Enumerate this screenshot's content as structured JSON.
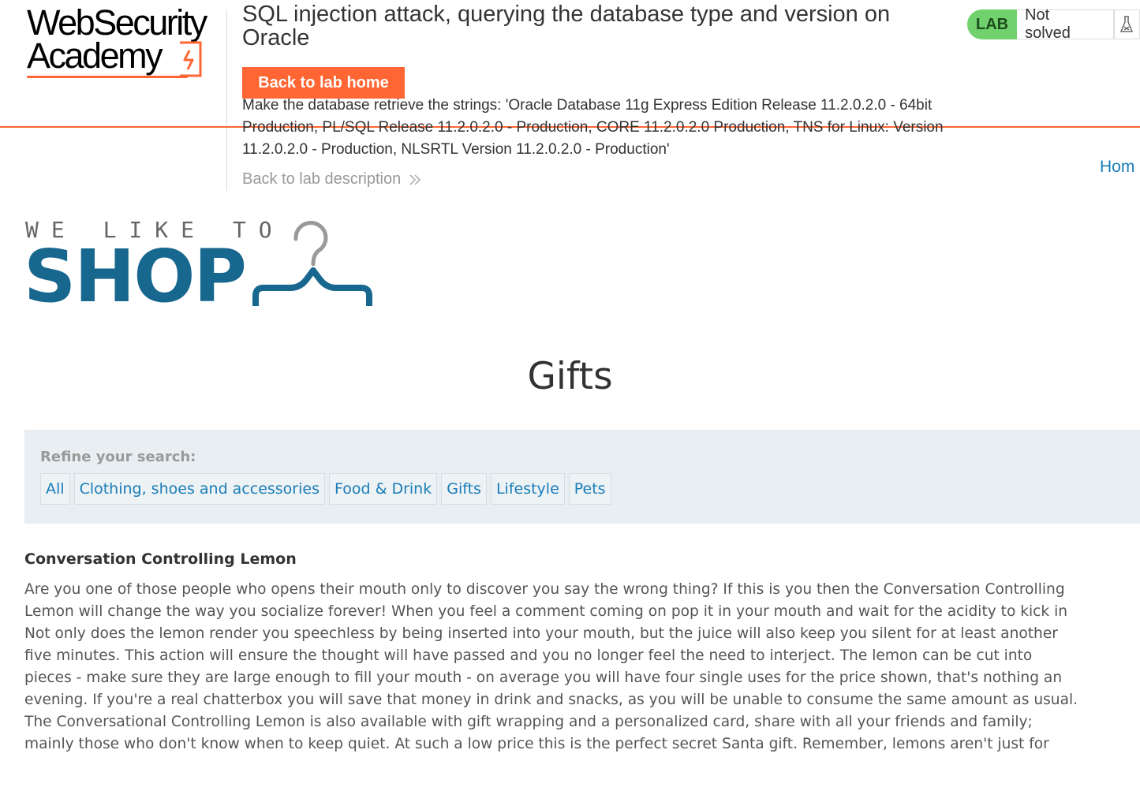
{
  "academy": {
    "logo_line1": "WebSecurity",
    "logo_line2": "Academy",
    "lab_title": "SQL injection attack, querying the database type and version on Oracle",
    "back_lab_home": "Back to lab home",
    "description": "Make the database retrieve the strings: 'Oracle Database 11g Express Edition Release 11.2.0.2.0 - 64bit Production, PL/SQL Release 11.2.0.2.0 - Production, CORE 11.2.0.2.0 Production, TNS for Linux: Version 11.2.0.2.0 - Production, NLSRTL Version 11.2.0.2.0 - Production'",
    "back_lab_description": "Back to lab description",
    "lab_badge": "LAB",
    "status": "Not solved",
    "accent_color": "#ff6633",
    "badge_color": "#70d16d"
  },
  "nav": {
    "home": "Hom"
  },
  "shop": {
    "tagline": "WE LIKE TO",
    "name": "SHOP",
    "brand_color": "#17678e"
  },
  "page": {
    "title": "Gifts"
  },
  "filters": {
    "label": "Refine your search:",
    "items": [
      "All",
      "Clothing, shoes and accessories",
      "Food & Drink",
      "Gifts",
      "Lifestyle",
      "Pets"
    ]
  },
  "product": {
    "name": "Conversation Controlling Lemon",
    "description": "Are you one of those people who opens their mouth only to discover you say the wrong thing? If this is you then the Conversation Controlling\nLemon will change the way you socialize forever! When you feel a comment coming on pop it in your mouth and wait for the acidity to kick in\nNot only does the lemon render you speechless by being inserted into your mouth, but the juice will also keep you silent for at least another\nfive minutes. This action will ensure the thought will have passed and you no longer feel the need to interject. The lemon can be cut into\npieces - make sure they are large enough to fill your mouth - on average you will have four single uses for the price shown, that's nothing an\nevening. If you're a real chatterbox you will save that money in drink and snacks, as you will be unable to consume the same amount as usual.\nThe Conversational Controlling Lemon is also available with gift wrapping and a personalized card, share with all your friends and family;\nmainly those who don't know when to keep quiet. At such a low price this is the perfect secret Santa gift. Remember, lemons aren't just for"
  }
}
